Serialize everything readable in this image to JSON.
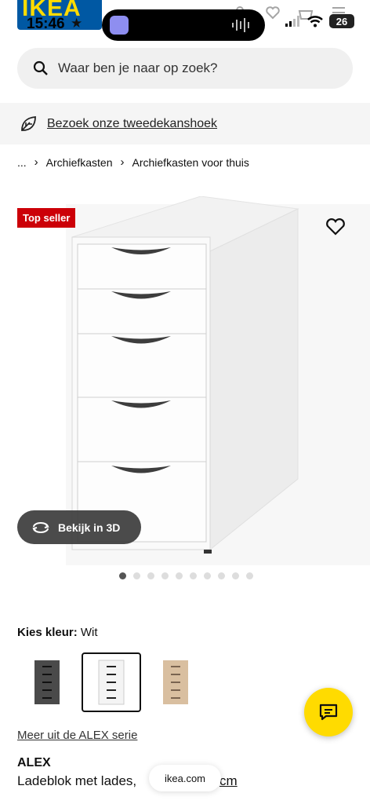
{
  "status_bar": {
    "time": "15:46",
    "battery": "26",
    "logo_text": "IKEA"
  },
  "search": {
    "placeholder": "Waar ben je naar op zoek?"
  },
  "banner": {
    "link_text": "Bezoek onze tweedekanshoek"
  },
  "breadcrumb": [
    "...",
    "Archiefkasten",
    "Archiefkasten voor thuis"
  ],
  "product_image": {
    "badge": "Top seller",
    "view_3d_label": "Bekijk in 3D",
    "carousel": {
      "total": 10,
      "active_index": 0
    }
  },
  "color": {
    "label": "Kies kleur:",
    "selected": "Wit",
    "options": [
      {
        "name": "donkergrijs",
        "hex": "#4a4a4a"
      },
      {
        "name": "wit",
        "hex": "#f4f4f4",
        "selected": true
      },
      {
        "name": "eikeneffect",
        "hex": "#d9bfa0"
      }
    ]
  },
  "series_link": "Meer uit de ALEX serie",
  "product": {
    "name": "ALEX",
    "description": "Ladeblok met lades,",
    "description_tail": "cm"
  },
  "browser": {
    "url": "ikea.com"
  },
  "colors": {
    "accent_yellow": "#ffdb00",
    "badge_red": "#cc0008",
    "ikea_blue": "#0058a3"
  }
}
